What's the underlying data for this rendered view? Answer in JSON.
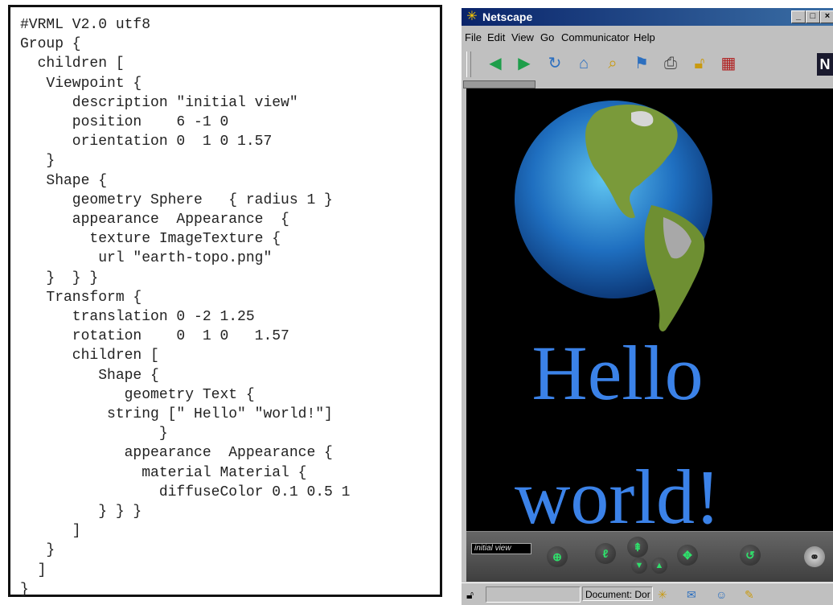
{
  "code": {
    "lines": [
      "#VRML V2.0 utf8",
      "Group {",
      "  children [",
      "   Viewpoint {",
      "      description \"initial view\"",
      "      position    6 -1 0",
      "      orientation 0  1 0 1.57",
      "   }",
      "   Shape {",
      "      geometry Sphere   { radius 1 }",
      "      appearance  Appearance  {",
      "        texture ImageTexture {",
      "         url \"earth-topo.png\"",
      "   }  } }",
      "   Transform {",
      "      translation 0 -2 1.25",
      "      rotation    0  1 0   1.57",
      "      children [",
      "         Shape {",
      "            geometry Text {",
      "          string [\" Hello\" \"world!\"]",
      "                }",
      "            appearance  Appearance {",
      "              material Material {",
      "                diffuseColor 0.1 0.5 1",
      "         } } }",
      "      ]",
      "   }",
      "  ]",
      "}"
    ]
  },
  "browser": {
    "title": "Netscape",
    "window_buttons": {
      "minimize": "_",
      "maximize": "□",
      "close": "×"
    },
    "menu": {
      "file": "File",
      "edit": "Edit",
      "view": "View",
      "go": "Go",
      "communicator": "Communicator",
      "help": "Help"
    },
    "toolbar_icons": [
      "back-icon",
      "forward-icon",
      "reload-icon",
      "home-icon",
      "search-icon",
      "guide-icon",
      "print-icon",
      "security-icon",
      "stop-icon"
    ],
    "logo": "N",
    "scene": {
      "line1": "Hello",
      "line2": "world!",
      "text_color": "#3b82e8",
      "background": "#000000"
    },
    "navbar": {
      "viewpoint": "initial view"
    },
    "status": {
      "text": "Document: Dor"
    }
  }
}
